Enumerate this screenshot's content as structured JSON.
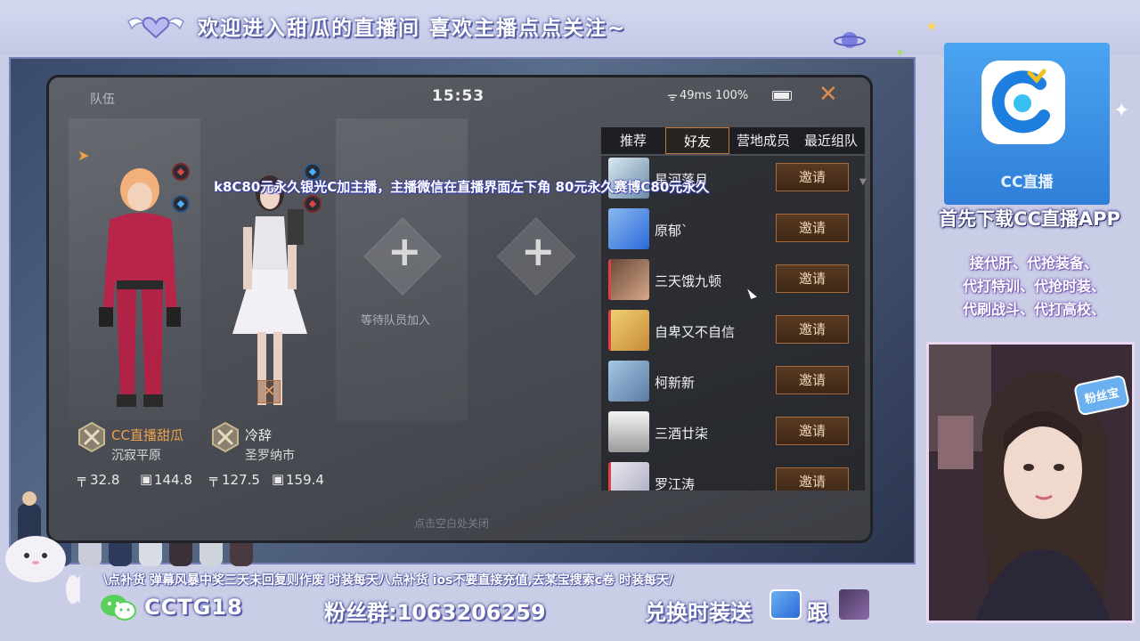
{
  "banner": {
    "text": "欢迎进入甜瓜的直播间 喜欢主播点点关注~"
  },
  "game": {
    "status": {
      "team_label": "队伍",
      "time": "15:53",
      "network": "49ms 100%"
    },
    "ticker": "k8C80元永久银光C加主播，主播微信在直播界面左下角 80元永久赛博C80元永久",
    "waiting_label": "等待队员加入",
    "footer_hint": "点击空白处关闭",
    "players": [
      {
        "name": "CC直播甜瓜",
        "region": "沉寂平原",
        "stat_a": "32.8",
        "stat_b": "144.8"
      },
      {
        "name": "冷辞",
        "region": "圣罗纳市",
        "stat_a": "127.5",
        "stat_b": "159.4"
      }
    ],
    "tabs": [
      {
        "label": "推荐",
        "active": false
      },
      {
        "label": "好友",
        "active": true
      },
      {
        "label": "营地成员",
        "active": false
      },
      {
        "label": "最近组队",
        "active": false
      }
    ],
    "invite_label": "邀请",
    "friends": [
      {
        "name": "星河落月"
      },
      {
        "name": "原郁`"
      },
      {
        "name": "三天饿九顿"
      },
      {
        "name": "自卑又不自信"
      },
      {
        "name": "柯新新"
      },
      {
        "name": "三酒廿柒"
      },
      {
        "name": "罗江涛"
      }
    ]
  },
  "right_panel": {
    "app_label": "CC直播",
    "promo_title": "首先下载CC直播APP",
    "promo_lines": [
      "接代肝、代抢装备、",
      "代打特训、代抢时装、",
      "代刷战斗、代打高校、"
    ],
    "fan_badge": "粉丝宝"
  },
  "bottom": {
    "notices": "\\点补货    弹幕风暴中奖三天未回复则作废    时装每天八点补货    ios不要直接充值,去某宝搜索c卷    时装每天/",
    "wechat_id": "CCTG18",
    "fan_group": "粉丝群:1063206259",
    "redeem": "兑换时装送",
    "follow": "跟"
  },
  "colors": {
    "accent_orange": "#e08a4a",
    "player_name_orange": "#f0a050",
    "frame_lavender": "#c9cde6",
    "app_blue": "#2f7fd8"
  }
}
